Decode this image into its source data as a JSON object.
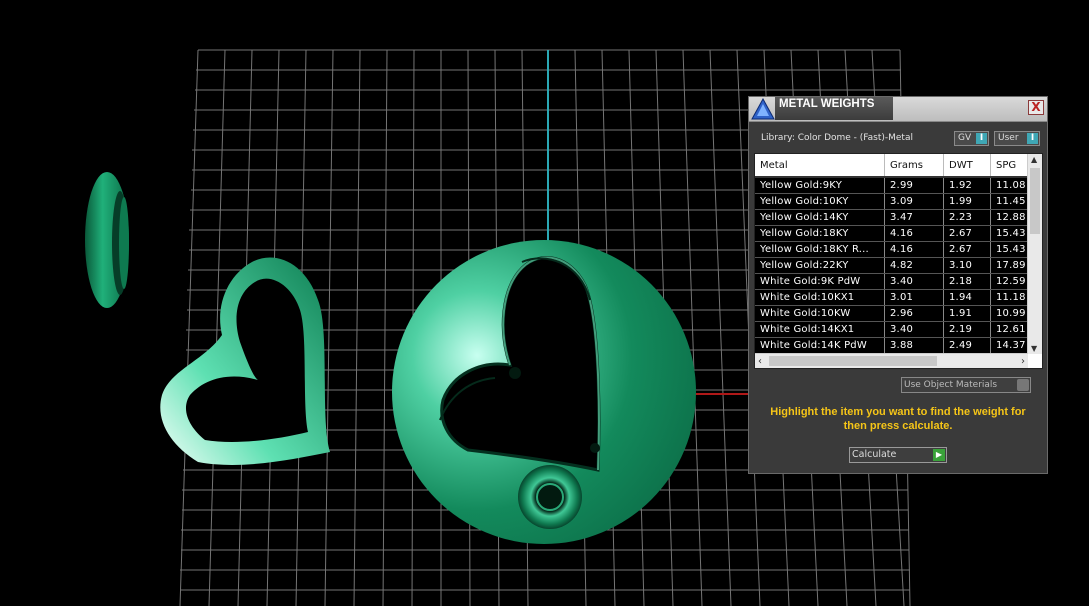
{
  "panel": {
    "title": "METAL WEIGHTS",
    "close_label": "X",
    "library_label": "Library: Color Dome - (Fast)-Metal",
    "gv_toggle": "GV",
    "user_toggle": "User",
    "columns": [
      "Metal",
      "Grams",
      "DWT",
      "SPG"
    ],
    "rows": [
      [
        "Yellow Gold:9KY",
        "2.99",
        "1.92",
        "11.08"
      ],
      [
        "Yellow Gold:10KY",
        "3.09",
        "1.99",
        "11.45"
      ],
      [
        "Yellow Gold:14KY",
        "3.47",
        "2.23",
        "12.88"
      ],
      [
        "Yellow Gold:18KY",
        "4.16",
        "2.67",
        "15.43"
      ],
      [
        "Yellow Gold:18KY R...",
        "4.16",
        "2.67",
        "15.43"
      ],
      [
        "Yellow Gold:22KY",
        "4.82",
        "3.10",
        "17.89"
      ],
      [
        "White Gold:9K PdW",
        "3.40",
        "2.18",
        "12.59"
      ],
      [
        "White Gold:10KX1",
        "3.01",
        "1.94",
        "11.18"
      ],
      [
        "White Gold:10KW",
        "2.96",
        "1.91",
        "10.99"
      ],
      [
        "White Gold:14KX1",
        "3.40",
        "2.19",
        "12.61"
      ],
      [
        "White Gold:14K PdW",
        "3.88",
        "2.49",
        "14.37"
      ]
    ],
    "use_object_materials": "Use Object Materials",
    "hint": "Highlight the item you want to find the weight for then press calculate.",
    "calculate_label": "Calculate"
  },
  "colors": {
    "background": "#000000",
    "grid": "#8a8a8a",
    "model_green": "#0f8a5a",
    "hint_yellow": "#f5c518",
    "axis_cyan": "#2aa8b5",
    "axis_red": "#b01818"
  }
}
